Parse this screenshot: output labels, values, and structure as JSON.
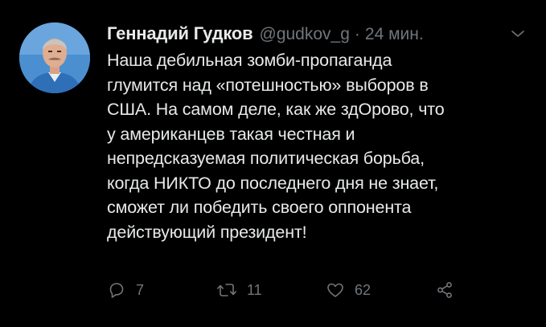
{
  "tweet": {
    "author_name": "Геннадий Гудков",
    "handle": "@gudkov_g",
    "separator": "·",
    "time": "24 мин.",
    "text_lines": [
      "Наша дебильная зомби-пропаганда",
      "глумится над «потешностью» выборов в",
      "США. На самом деле, как же здОрово, что",
      "у американцев такая честная и",
      "непредсказуемая политическая борьба,",
      "когда НИКТО до последнего дня не знает,",
      "сможет ли победить своего оппонента",
      "действующий президент!"
    ],
    "actions": {
      "reply_count": "7",
      "retweet_count": "11",
      "like_count": "62"
    }
  },
  "icons": {
    "caret": "chevron-down-icon",
    "reply": "reply-icon",
    "retweet": "retweet-icon",
    "like": "heart-icon",
    "share": "share-icon"
  },
  "colors": {
    "background": "#000000",
    "primary_text": "#e7e9ea",
    "secondary_text": "#71767b"
  }
}
